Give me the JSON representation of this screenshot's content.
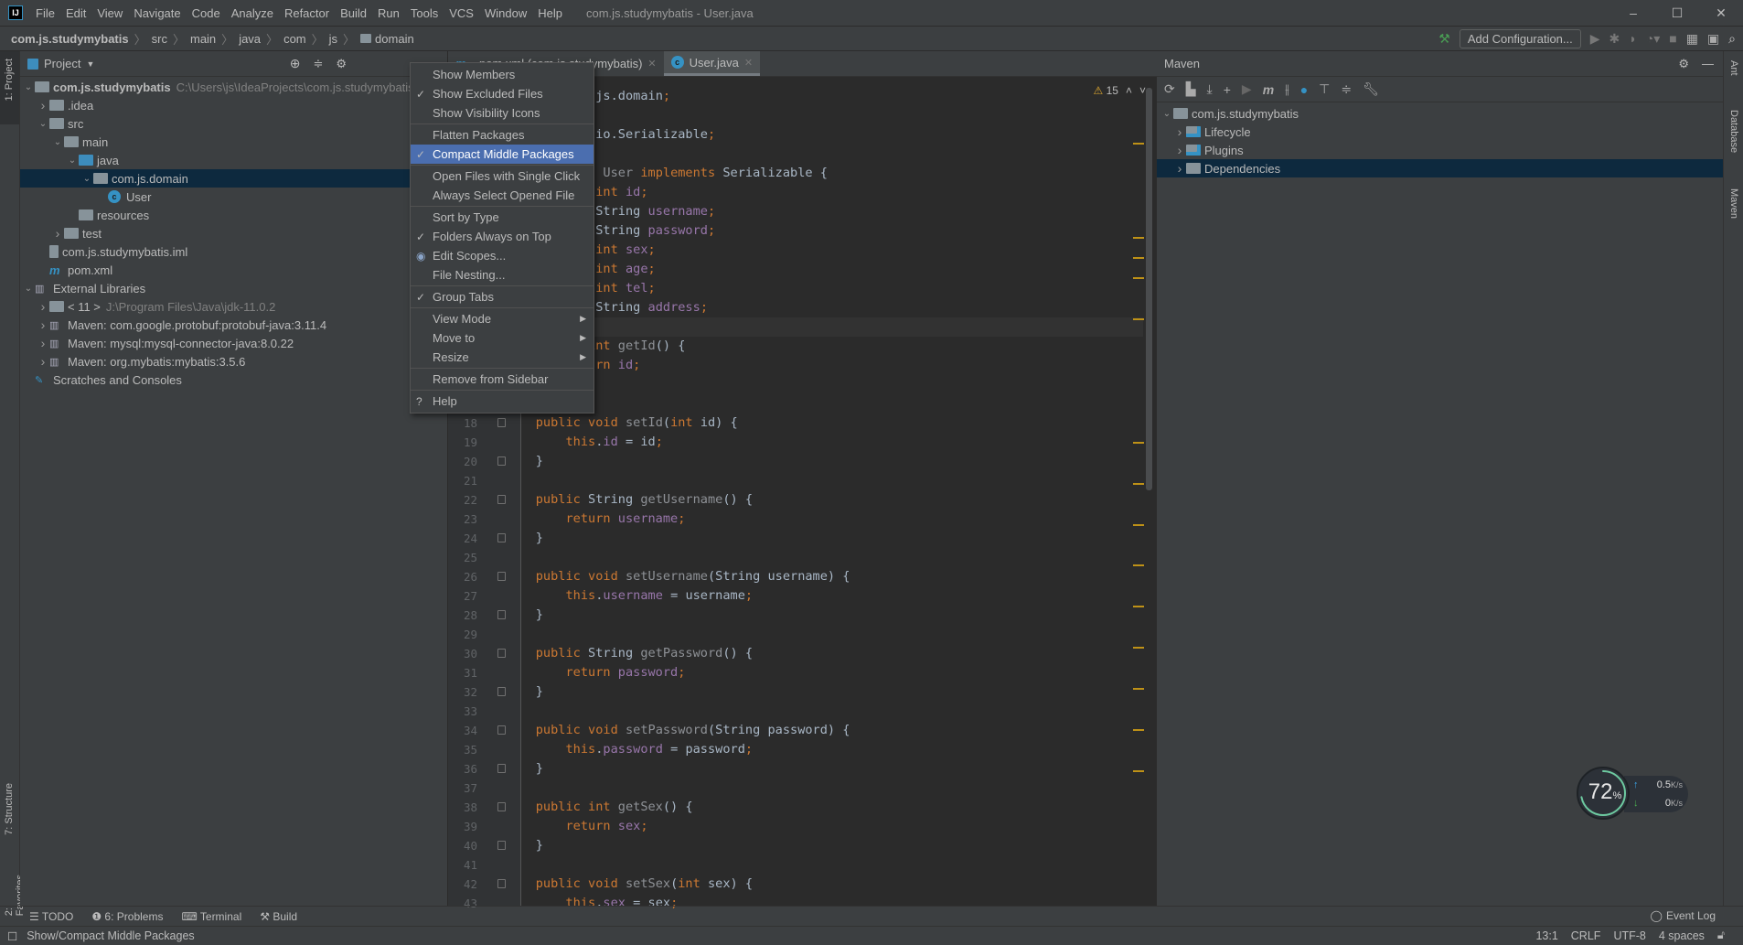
{
  "menubar": {
    "items": [
      "File",
      "Edit",
      "View",
      "Navigate",
      "Code",
      "Analyze",
      "Refactor",
      "Build",
      "Run",
      "Tools",
      "VCS",
      "Window",
      "Help"
    ],
    "title": "com.js.studymybatis - User.java"
  },
  "breadcrumb": [
    "com.js.studymybatis",
    "src",
    "main",
    "java",
    "com",
    "js",
    "domain"
  ],
  "runbar": {
    "add_config": "Add Configuration..."
  },
  "left_strip": {
    "project": "1: Project",
    "structure": "7: Structure",
    "favorites": "2: Favorites"
  },
  "right_strip": {
    "ant": "Ant",
    "database": "Database",
    "maven": "Maven"
  },
  "project": {
    "title": "Project",
    "tree": [
      {
        "label": "com.js.studymybatis",
        "hint": "C:\\Users\\js\\IdeaProjects\\com.js.studymybatis",
        "level": 0,
        "chev": "down",
        "icon": "module",
        "bold": true
      },
      {
        "label": ".idea",
        "level": 1,
        "chev": "right",
        "icon": "folder"
      },
      {
        "label": "src",
        "level": 1,
        "chev": "down",
        "icon": "folder"
      },
      {
        "label": "main",
        "level": 2,
        "chev": "down",
        "icon": "folder"
      },
      {
        "label": "java",
        "level": 3,
        "chev": "down",
        "icon": "folder-blue"
      },
      {
        "label": "com.js.domain",
        "level": 4,
        "chev": "down",
        "icon": "package",
        "selected": true
      },
      {
        "label": "User",
        "level": 5,
        "icon": "class"
      },
      {
        "label": "resources",
        "level": 3,
        "icon": "folder-res"
      },
      {
        "label": "test",
        "level": 2,
        "chev": "right",
        "icon": "folder"
      },
      {
        "label": "com.js.studymybatis.iml",
        "level": 1,
        "icon": "file"
      },
      {
        "label": "pom.xml",
        "level": 1,
        "icon": "maven"
      },
      {
        "label": "External Libraries",
        "level": 0,
        "chev": "down",
        "icon": "library"
      },
      {
        "label": "< 11 >",
        "hint": "J:\\Program Files\\Java\\jdk-11.0.2",
        "level": 1,
        "chev": "right",
        "icon": "jdk"
      },
      {
        "label": "Maven: com.google.protobuf:protobuf-java:3.11.4",
        "level": 1,
        "chev": "right",
        "icon": "library"
      },
      {
        "label": "Maven: mysql:mysql-connector-java:8.0.22",
        "level": 1,
        "chev": "right",
        "icon": "library"
      },
      {
        "label": "Maven: org.mybatis:mybatis:3.5.6",
        "level": 1,
        "chev": "right",
        "icon": "library"
      },
      {
        "label": "Scratches and Consoles",
        "level": 0,
        "icon": "scratch"
      }
    ]
  },
  "editor": {
    "tabs": [
      {
        "label": "pom.xml (com.js.studymybatis)",
        "active": false
      },
      {
        "label": "User.java",
        "active": true
      }
    ],
    "warnings": "15",
    "current_line": 13,
    "lines": [
      [
        [
          "k",
          "package "
        ],
        [
          "t",
          "com.js.domain"
        ],
        [
          "s",
          ";"
        ]
      ],
      [],
      [
        [
          "k",
          "import "
        ],
        [
          "t",
          "java.io.Serializable"
        ],
        [
          "s",
          ";"
        ]
      ],
      [],
      [
        [
          "k",
          "public class "
        ],
        [
          "m",
          "User "
        ],
        [
          "k",
          "implements "
        ],
        [
          "t",
          "Serializable {"
        ]
      ],
      [
        [
          "k",
          "    private int "
        ],
        [
          "f",
          "id"
        ],
        [
          "s",
          ";"
        ]
      ],
      [
        [
          "k",
          "    private "
        ],
        [
          "t",
          "String "
        ],
        [
          "f",
          "username"
        ],
        [
          "s",
          ";"
        ]
      ],
      [
        [
          "k",
          "    private "
        ],
        [
          "t",
          "String "
        ],
        [
          "f",
          "password"
        ],
        [
          "s",
          ";"
        ]
      ],
      [
        [
          "k",
          "    private int "
        ],
        [
          "f",
          "sex"
        ],
        [
          "s",
          ";"
        ]
      ],
      [
        [
          "k",
          "    private int "
        ],
        [
          "f",
          "age"
        ],
        [
          "s",
          ";"
        ]
      ],
      [
        [
          "k",
          "    private int "
        ],
        [
          "f",
          "tel"
        ],
        [
          "s",
          ";"
        ]
      ],
      [
        [
          "k",
          "    private "
        ],
        [
          "t",
          "String "
        ],
        [
          "f",
          "address"
        ],
        [
          "s",
          ";"
        ]
      ],
      [],
      [
        [
          "k",
          "    public int "
        ],
        [
          "m",
          "getId"
        ],
        [
          "t",
          "() {"
        ]
      ],
      [
        [
          "k",
          "        return "
        ],
        [
          "f",
          "id"
        ],
        [
          "s",
          ";"
        ]
      ],
      [
        [
          "t",
          "    }"
        ]
      ],
      [],
      [
        [
          "k",
          "    public void "
        ],
        [
          "m",
          "setId"
        ],
        [
          "t",
          "("
        ],
        [
          "k",
          "int "
        ],
        [
          "t",
          "id) {"
        ]
      ],
      [
        [
          "k",
          "        this"
        ],
        [
          "t",
          "."
        ],
        [
          "f",
          "id"
        ],
        [
          "t",
          " = id"
        ],
        [
          "s",
          ";"
        ]
      ],
      [
        [
          "t",
          "    }"
        ]
      ],
      [],
      [
        [
          "k",
          "    public "
        ],
        [
          "t",
          "String "
        ],
        [
          "m",
          "getUsername"
        ],
        [
          "t",
          "() {"
        ]
      ],
      [
        [
          "k",
          "        return "
        ],
        [
          "f",
          "username"
        ],
        [
          "s",
          ";"
        ]
      ],
      [
        [
          "t",
          "    }"
        ]
      ],
      [],
      [
        [
          "k",
          "    public void "
        ],
        [
          "m",
          "setUsername"
        ],
        [
          "t",
          "(String username) {"
        ]
      ],
      [
        [
          "k",
          "        this"
        ],
        [
          "t",
          "."
        ],
        [
          "f",
          "username"
        ],
        [
          "t",
          " = username"
        ],
        [
          "s",
          ";"
        ]
      ],
      [
        [
          "t",
          "    }"
        ]
      ],
      [],
      [
        [
          "k",
          "    public "
        ],
        [
          "t",
          "String "
        ],
        [
          "m",
          "getPassword"
        ],
        [
          "t",
          "() {"
        ]
      ],
      [
        [
          "k",
          "        return "
        ],
        [
          "f",
          "password"
        ],
        [
          "s",
          ";"
        ]
      ],
      [
        [
          "t",
          "    }"
        ]
      ],
      [],
      [
        [
          "k",
          "    public void "
        ],
        [
          "m",
          "setPassword"
        ],
        [
          "t",
          "(String password) {"
        ]
      ],
      [
        [
          "k",
          "        this"
        ],
        [
          "t",
          "."
        ],
        [
          "f",
          "password"
        ],
        [
          "t",
          " = password"
        ],
        [
          "s",
          ";"
        ]
      ],
      [
        [
          "t",
          "    }"
        ]
      ],
      [],
      [
        [
          "k",
          "    public int "
        ],
        [
          "m",
          "getSex"
        ],
        [
          "t",
          "() {"
        ]
      ],
      [
        [
          "k",
          "        return "
        ],
        [
          "f",
          "sex"
        ],
        [
          "s",
          ";"
        ]
      ],
      [
        [
          "t",
          "    }"
        ]
      ],
      [],
      [
        [
          "k",
          "    public void "
        ],
        [
          "m",
          "setSex"
        ],
        [
          "t",
          "("
        ],
        [
          "k",
          "int "
        ],
        [
          "t",
          "sex) {"
        ]
      ],
      [
        [
          "k",
          "        this"
        ],
        [
          "t",
          "."
        ],
        [
          "f",
          "sex"
        ],
        [
          "t",
          " = sex"
        ],
        [
          "s",
          ";"
        ]
      ]
    ]
  },
  "context_menu": {
    "items": [
      {
        "label": "Show Members"
      },
      {
        "label": "Show Excluded Files",
        "mark": "check"
      },
      {
        "label": "Show Visibility Icons"
      },
      {
        "sep": true
      },
      {
        "label": "Flatten Packages"
      },
      {
        "label": "Compact Middle Packages",
        "mark": "check",
        "selected": true
      },
      {
        "sep": true
      },
      {
        "label": "Open Files with Single Click"
      },
      {
        "label": "Always Select Opened File"
      },
      {
        "sep": true
      },
      {
        "label": "Sort by Type"
      },
      {
        "label": "Folders Always on Top",
        "mark": "check"
      },
      {
        "label": "Edit Scopes...",
        "mark": "radio"
      },
      {
        "label": "File Nesting..."
      },
      {
        "sep": true
      },
      {
        "label": "Group Tabs",
        "mark": "check"
      },
      {
        "sep": true
      },
      {
        "label": "View Mode",
        "submenu": true
      },
      {
        "label": "Move to",
        "submenu": true
      },
      {
        "label": "Resize",
        "submenu": true
      },
      {
        "sep": true
      },
      {
        "label": "Remove from Sidebar"
      },
      {
        "sep": true
      },
      {
        "label": "Help",
        "mark": "help"
      }
    ]
  },
  "maven": {
    "title": "Maven",
    "tree": [
      {
        "label": "com.js.studymybatis",
        "level": 0,
        "chev": "down"
      },
      {
        "label": "Lifecycle",
        "level": 1,
        "chev": "right"
      },
      {
        "label": "Plugins",
        "level": 1,
        "chev": "right"
      },
      {
        "label": "Dependencies",
        "level": 1,
        "chev": "right",
        "selected": true
      }
    ]
  },
  "bottom_tools": [
    "TODO",
    "6: Problems",
    "Terminal",
    "Build"
  ],
  "event_log": "Event Log",
  "status": {
    "message": "Show/Compact Middle Packages",
    "position": "13:1",
    "line_sep": "CRLF",
    "encoding": "UTF-8",
    "indent": "4 spaces"
  },
  "widget": {
    "cpu_percent": "72",
    "pct_sign": "%",
    "up": "0.5",
    "down": "0",
    "unit": "K/s"
  },
  "colors": {
    "keyword": "#cc7832",
    "field": "#9876aa",
    "text": "#a9b7c6",
    "selection": "#4b6eaf",
    "tree_selection": "#0d293e",
    "editor_bg": "#2b2b2b",
    "panel_bg": "#3c3f41"
  }
}
